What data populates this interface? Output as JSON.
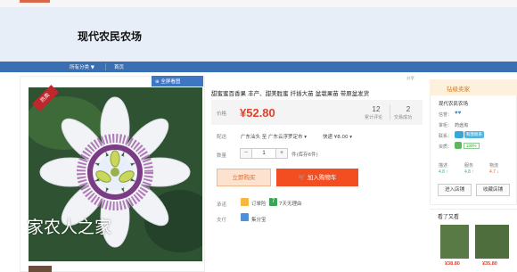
{
  "header": {
    "shop_title": "现代农民农场"
  },
  "nav": {
    "all_categories": "所有分类 ▼",
    "home": "首页"
  },
  "gallery": {
    "fullscreen_label": "全屏看图",
    "corner_badge": "热卖",
    "watermark": "家农人之家"
  },
  "product": {
    "name": "甜蜜蜜百香果 丰产、甜美胜蜜 扦插大苗 盆栽果苗 带原盆发货",
    "share_label": "分享",
    "price_label": "价格",
    "price": "¥52.80",
    "reviews_count": "12",
    "reviews_label": "累计评论",
    "sales_count": "2",
    "sales_label": "交易成功",
    "shipping_label": "配送",
    "shipping_route": "广东汕头 至   广东云浮罗定市 ▾",
    "shipping_fee": "快递 ¥8.00 ▾",
    "quantity_label": "数量",
    "quantity_minus": "−",
    "quantity_value": "1",
    "quantity_plus": "+",
    "stock_text": "件(库存6件)",
    "buy_now_label": "立即购买",
    "add_to_cart_label": "加入购物车",
    "promise_label": "承诺",
    "promise_1": "订单险",
    "promise_2": "7天无理由",
    "payment_label": "支付",
    "payment_method": "集分宝"
  },
  "shop_card": {
    "title": "钻级卖家",
    "shop_name": "现代农民农场",
    "credit_label": "信誉：",
    "credit_icons": "♥♥",
    "owner_label": "掌柜：",
    "owner_value": "药途淘",
    "contact_label": "联系：",
    "contact_value": "和我联系",
    "quality_label": "资质：",
    "quality_value": "100%",
    "rate_desc_label": "描述",
    "rate_serv_label": "服务",
    "rate_ship_label": "物流",
    "rate_desc_value": "4.8 ↑",
    "rate_serv_value": "4.8 ↑",
    "rate_ship_value": "4.7 ↓",
    "enter_shop_label": "进入店铺",
    "fav_shop_label": "收藏店铺"
  },
  "viewed": {
    "title": "看了又看",
    "items": [
      {
        "price": "¥38.80"
      },
      {
        "price": "¥35.80"
      }
    ]
  },
  "colors": {
    "nav_bg": "#3a6fb3",
    "banner_bg": "#e8eef7",
    "price": "#e3412a",
    "add_cart": "#f24e22",
    "buy_now_bg": "#fde3cf"
  }
}
